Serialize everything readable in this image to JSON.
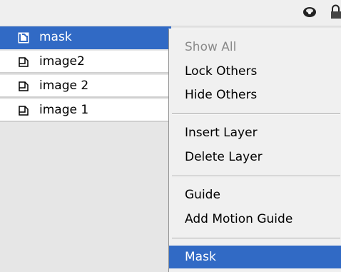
{
  "header": {
    "icons": [
      "eye-icon",
      "lock-icon"
    ]
  },
  "layers": [
    {
      "name": "mask",
      "icon": "layer-icon",
      "selected": true
    },
    {
      "name": "image2",
      "icon": "layer-icon",
      "selected": false
    },
    {
      "name": "image 2",
      "icon": "layer-icon",
      "selected": false
    },
    {
      "name": "image 1",
      "icon": "layer-icon",
      "selected": false
    }
  ],
  "context_menu": {
    "items": [
      {
        "label": "Show All",
        "enabled": false
      },
      {
        "label": "Lock Others",
        "enabled": true
      },
      {
        "label": "Hide Others",
        "enabled": true
      },
      {
        "label": "Insert Layer",
        "enabled": true
      },
      {
        "label": "Delete Layer",
        "enabled": true
      },
      {
        "label": "Guide",
        "enabled": true
      },
      {
        "label": "Add Motion Guide",
        "enabled": true
      },
      {
        "label": "Mask",
        "enabled": true,
        "highlighted": true
      }
    ]
  },
  "colors": {
    "selection": "#316ac5",
    "menu_background": "#f0f0f0",
    "disabled_text": "#8a8a8a"
  }
}
